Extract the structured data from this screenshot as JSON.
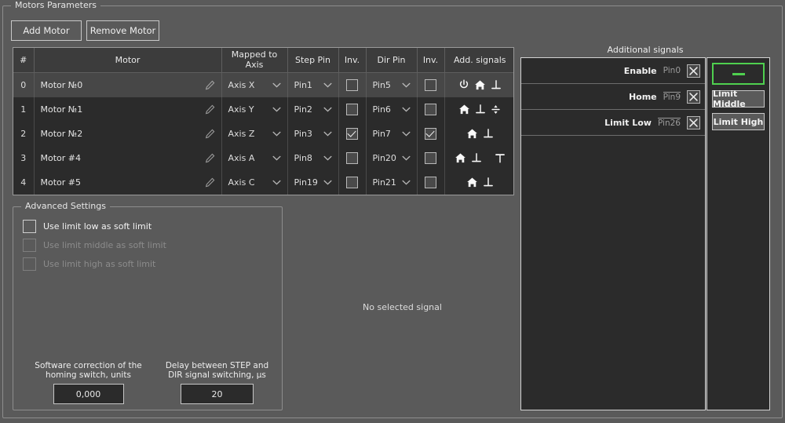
{
  "group": {
    "title": "Motors Parameters"
  },
  "toolbar": {
    "add_motor_label": "Add Motor",
    "remove_motor_label": "Remove Motor"
  },
  "table": {
    "headers": [
      "#",
      "Motor",
      "Mapped to Axis",
      "Step Pin",
      "Inv.",
      "Dir Pin",
      "Inv.",
      "Add. signals"
    ],
    "rows": [
      {
        "index": "0",
        "motor": "Motor №0",
        "axis": "Axis X",
        "step_pin": "Pin1",
        "step_inv": false,
        "dir_pin": "Pin5",
        "dir_inv": false,
        "signals": [
          "power-icon",
          "home-icon",
          "limit-low-icon"
        ],
        "selected": true
      },
      {
        "index": "1",
        "motor": "Motor №1",
        "axis": "Axis Y",
        "step_pin": "Pin2",
        "step_inv": false,
        "dir_pin": "Pin6",
        "dir_inv": false,
        "signals": [
          "home-icon",
          "limit-low-icon",
          "limit-middle-icon"
        ],
        "selected": false
      },
      {
        "index": "2",
        "motor": "Motor №2",
        "axis": "Axis Z",
        "step_pin": "Pin3",
        "step_inv": true,
        "dir_pin": "Pin7",
        "dir_inv": true,
        "signals": [
          "home-icon",
          "limit-low-icon"
        ],
        "selected": false
      },
      {
        "index": "3",
        "motor": "Motor #4",
        "axis": "Axis A",
        "step_pin": "Pin8",
        "step_inv": false,
        "dir_pin": "Pin20",
        "dir_inv": false,
        "signals": [
          "home-icon",
          "limit-low-icon",
          "limit-high-icon"
        ],
        "selected": false
      },
      {
        "index": "4",
        "motor": "Motor #5",
        "axis": "Axis C",
        "step_pin": "Pin19",
        "step_inv": false,
        "dir_pin": "Pin21",
        "dir_inv": false,
        "signals": [
          "home-icon",
          "limit-low-icon"
        ],
        "selected": false
      }
    ]
  },
  "advanced": {
    "title": "Advanced Settings",
    "checkboxes": [
      {
        "label": "Use limit low as soft limit",
        "checked": false,
        "disabled": false
      },
      {
        "label": "Use limit middle as soft limit",
        "checked": false,
        "disabled": true
      },
      {
        "label": "Use limit high as soft limit",
        "checked": false,
        "disabled": true
      }
    ],
    "fields": [
      {
        "label": "Software correction of the homing switch, units",
        "value": "0,000"
      },
      {
        "label": "Delay between STEP and DIR signal switching, µs",
        "value": "20"
      }
    ]
  },
  "center": {
    "no_selection_text": "No selected signal"
  },
  "additional_signals": {
    "title": "Additional signals",
    "rows": [
      {
        "name": "Enable",
        "pin": "Pin0",
        "inverted": false,
        "remove_icon": "close-icon"
      },
      {
        "name": "Home",
        "pin": "Pin9",
        "inverted": true,
        "remove_icon": "close-icon"
      },
      {
        "name": "Limit Low",
        "pin": "Pin26",
        "inverted": true,
        "remove_icon": "close-icon"
      }
    ],
    "buttons": [
      {
        "label": "",
        "icon": "minus-icon",
        "active": true
      },
      {
        "label": "Limit Middle",
        "icon": null,
        "active": false
      },
      {
        "label": "Limit High",
        "icon": null,
        "active": false
      }
    ]
  },
  "colors": {
    "window_bg": "#5a5a5a",
    "panel_bg": "#2b2b2b",
    "header_bg": "#3c3c3c",
    "row_selected": "#474747",
    "border": "#c8c8c8",
    "text": "#ededed",
    "text_dim": "#9b9b9b",
    "accent_green": "#4fd04f"
  }
}
